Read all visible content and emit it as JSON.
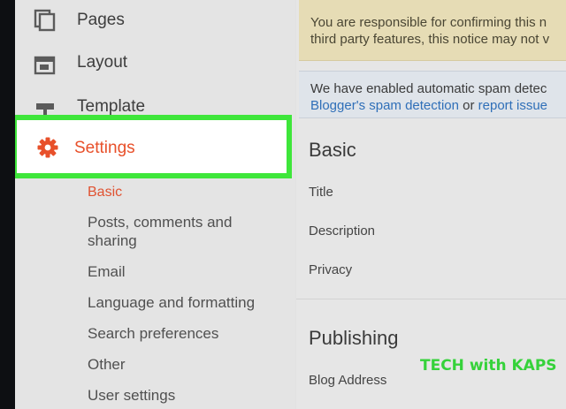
{
  "sidebar": {
    "items": [
      {
        "label": "Pages",
        "icon": "pages-icon"
      },
      {
        "label": "Layout",
        "icon": "layout-icon"
      },
      {
        "label": "Template",
        "icon": "template-icon"
      },
      {
        "label": "Settings",
        "icon": "gear-icon"
      }
    ],
    "settings_sub": [
      {
        "label": "Basic"
      },
      {
        "label": "Posts, comments and sharing"
      },
      {
        "label": "Email"
      },
      {
        "label": "Language and formatting"
      },
      {
        "label": "Search preferences"
      },
      {
        "label": "Other"
      },
      {
        "label": "User settings"
      }
    ]
  },
  "main": {
    "notice_responsibility": {
      "line1": "You are responsible for confirming this n",
      "line2": "third party features, this notice may not v"
    },
    "notice_spam": {
      "text1": "We have enabled automatic spam detec",
      "link1": "Blogger's spam detection",
      "text2": " or ",
      "link2": "report issue"
    },
    "basic": {
      "title": "Basic",
      "fields": [
        "Title",
        "Description",
        "Privacy"
      ]
    },
    "publishing": {
      "title": "Publishing",
      "fields": [
        "Blog Address"
      ]
    }
  },
  "watermark": "TECH with KAPS",
  "colors": {
    "accent": "#e8502a",
    "highlight_border": "#3ee63a",
    "link": "#2f6fb8",
    "watermark": "#35d23a"
  }
}
